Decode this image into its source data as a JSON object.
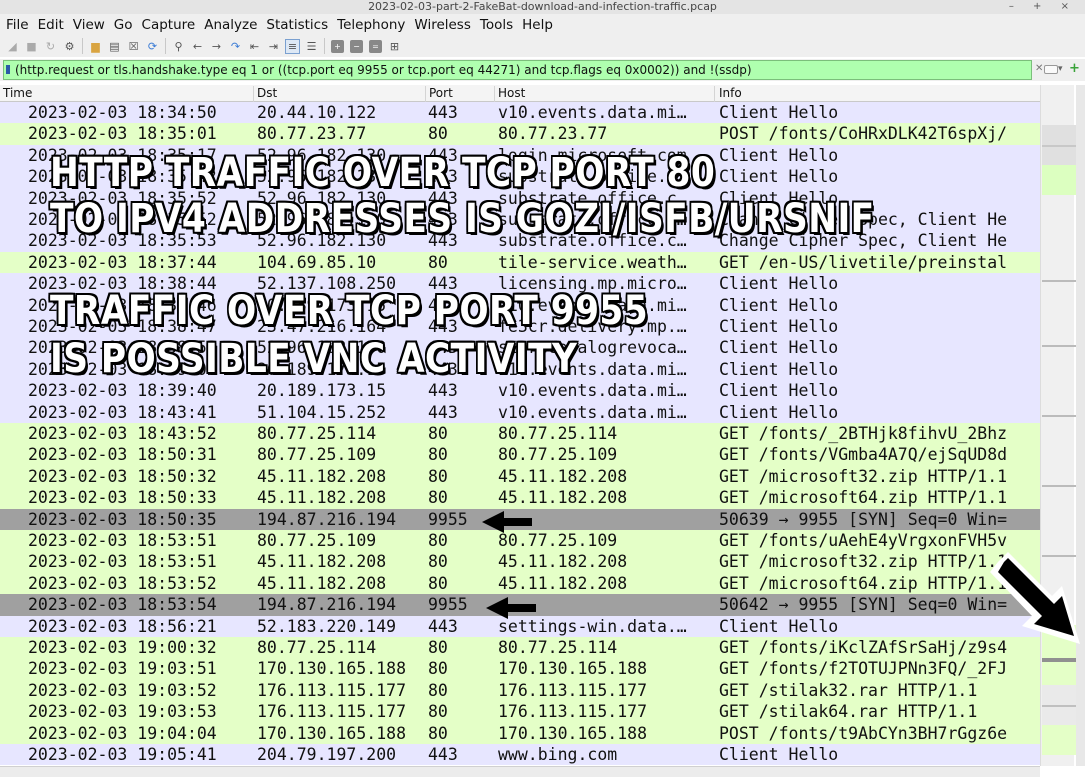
{
  "window": {
    "title": "2023-02-03-part-2-FakeBat-download-and-infection-traffic.pcap",
    "controls": "– + ×"
  },
  "menu": [
    "File",
    "Edit",
    "View",
    "Go",
    "Capture",
    "Analyze",
    "Statistics",
    "Telephony",
    "Wireless",
    "Tools",
    "Help"
  ],
  "toolbar": {
    "icons": [
      "shark-fin-icon",
      "stop-icon",
      "restart-icon",
      "options-gear-icon",
      "open-folder-icon",
      "file-icon",
      "close-file-icon",
      "reload-icon",
      "search-icon",
      "back-icon",
      "forward-icon",
      "jump-icon",
      "first-packet-icon",
      "last-packet-icon",
      "autoscroll-icon",
      "colorize-icon",
      "zoom-in-icon",
      "zoom-out-icon",
      "normal-size-icon",
      "resize-columns-icon"
    ]
  },
  "filter": {
    "value": "(http.request or tls.handshake.type eq 1 or ((tcp.port eq 9955 or tcp.port eq 44271) and tcp.flags eq 0x0002)) and !(ssdp)",
    "bg_color": "#afffaf"
  },
  "columns": [
    "Time",
    "Dst",
    "Port",
    "Host",
    "Info"
  ],
  "packets": [
    {
      "time": "2023-02-03 18:34:50",
      "dst": "20.44.10.122",
      "port": "443",
      "host": "v10.events.data.mi…",
      "info": "Client Hello",
      "type": "tls"
    },
    {
      "time": "2023-02-03 18:35:01",
      "dst": "80.77.23.77",
      "port": "80",
      "host": "80.77.23.77",
      "info": "POST /fonts/CoHRxDLK42T6spXj/",
      "type": "http"
    },
    {
      "time": "2023-02-03 18:35:17",
      "dst": "52.96.182.130",
      "port": "443",
      "host": "login.microsoft.com",
      "info": "Client Hello",
      "type": "tls"
    },
    {
      "time": "2023-02-03 18:35:42",
      "dst": "52.96.182.130",
      "port": "443",
      "host": "substrate.office.c…",
      "info": "Client Hello",
      "type": "tls"
    },
    {
      "time": "2023-02-03 18:35:52",
      "dst": "52.96.182.130",
      "port": "443",
      "host": "substrate.office.c…",
      "info": "Client Hello",
      "type": "tls"
    },
    {
      "time": "2023-02-03 18:35:52",
      "dst": "52.96.182.130",
      "port": "443",
      "host": "substrate.office.c…",
      "info": "Change Cipher Spec, Client He",
      "type": "tls"
    },
    {
      "time": "2023-02-03 18:35:53",
      "dst": "52.96.182.130",
      "port": "443",
      "host": "substrate.office.c…",
      "info": "Change Cipher Spec, Client He",
      "type": "tls"
    },
    {
      "time": "2023-02-03 18:37:44",
      "dst": "104.69.85.10",
      "port": "80",
      "host": "tile-service.weath…",
      "info": "GET /en-US/livetile/preinstal",
      "type": "http"
    },
    {
      "time": "2023-02-03 18:38:44",
      "dst": "52.137.108.250",
      "port": "443",
      "host": "licensing.mp.micro…",
      "info": "Client Hello",
      "type": "tls"
    },
    {
      "time": "2023-02-03 18:38:46",
      "dst": "20.189.173.15",
      "port": "443",
      "host": "v10.events.data.mi…",
      "info": "Client Hello",
      "type": "tls"
    },
    {
      "time": "2023-02-03 18:38:47",
      "dst": "23.47.216.164",
      "port": "443",
      "host": "fe3cr.delivery.mp.…",
      "info": "Client Hello",
      "type": "tls"
    },
    {
      "time": "2023-02-03 18:38:52",
      "dst": "52.96.182.130",
      "port": "443",
      "host": "storecatalogrevoca…",
      "info": "Client Hello",
      "type": "tls"
    },
    {
      "time": "2023-02-03 18:39:02",
      "dst": "20.189.173.15",
      "port": "443",
      "host": "v10.events.data.mi…",
      "info": "Client Hello",
      "type": "tls"
    },
    {
      "time": "2023-02-03 18:39:40",
      "dst": "20.189.173.15",
      "port": "443",
      "host": "v10.events.data.mi…",
      "info": "Client Hello",
      "type": "tls"
    },
    {
      "time": "2023-02-03 18:43:41",
      "dst": "51.104.15.252",
      "port": "443",
      "host": "v10.events.data.mi…",
      "info": "Client Hello",
      "type": "tls"
    },
    {
      "time": "2023-02-03 18:43:52",
      "dst": "80.77.25.114",
      "port": "80",
      "host": "80.77.25.114",
      "info": "GET /fonts/_2BTHjk8fihvU_2Bhz",
      "type": "http"
    },
    {
      "time": "2023-02-03 18:50:31",
      "dst": "80.77.25.109",
      "port": "80",
      "host": "80.77.25.109",
      "info": "GET /fonts/VGmba4A7Q/ejSqUD8d",
      "type": "http"
    },
    {
      "time": "2023-02-03 18:50:32",
      "dst": "45.11.182.208",
      "port": "80",
      "host": "45.11.182.208",
      "info": "GET /microsoft32.zip HTTP/1.1",
      "type": "http"
    },
    {
      "time": "2023-02-03 18:50:33",
      "dst": "45.11.182.208",
      "port": "80",
      "host": "45.11.182.208",
      "info": "GET /microsoft64.zip HTTP/1.1",
      "type": "http"
    },
    {
      "time": "2023-02-03 18:50:35",
      "dst": "194.87.216.194",
      "port": "9955",
      "host": "",
      "info": "50639 → 9955 [SYN] Seq=0 Win=",
      "type": "syn"
    },
    {
      "time": "2023-02-03 18:53:51",
      "dst": "80.77.25.109",
      "port": "80",
      "host": "80.77.25.109",
      "info": "GET /fonts/uAehE4yVrgxonFVH5v",
      "type": "http"
    },
    {
      "time": "2023-02-03 18:53:51",
      "dst": "45.11.182.208",
      "port": "80",
      "host": "45.11.182.208",
      "info": "GET /microsoft32.zip HTTP/1.1",
      "type": "http"
    },
    {
      "time": "2023-02-03 18:53:52",
      "dst": "45.11.182.208",
      "port": "80",
      "host": "45.11.182.208",
      "info": "GET /microsoft64.zip HTTP/1.1",
      "type": "http"
    },
    {
      "time": "2023-02-03 18:53:54",
      "dst": "194.87.216.194",
      "port": "9955",
      "host": "",
      "info": "50642 → 9955 [SYN] Seq=0 Win=",
      "type": "syn"
    },
    {
      "time": "2023-02-03 18:56:21",
      "dst": "52.183.220.149",
      "port": "443",
      "host": "settings-win.data.…",
      "info": "Client Hello",
      "type": "tls"
    },
    {
      "time": "2023-02-03 19:00:32",
      "dst": "80.77.25.114",
      "port": "80",
      "host": "80.77.25.114",
      "info": "GET /fonts/iKclZAfSrSaHj/z9s4",
      "type": "http"
    },
    {
      "time": "2023-02-03 19:03:51",
      "dst": "170.130.165.188",
      "port": "80",
      "host": "170.130.165.188",
      "info": "GET /fonts/f2TOTUJPNn3FQ/_2FJ",
      "type": "http"
    },
    {
      "time": "2023-02-03 19:03:52",
      "dst": "176.113.115.177",
      "port": "80",
      "host": "176.113.115.177",
      "info": "GET /stilak32.rar HTTP/1.1",
      "type": "http"
    },
    {
      "time": "2023-02-03 19:03:53",
      "dst": "176.113.115.177",
      "port": "80",
      "host": "176.113.115.177",
      "info": "GET /stilak64.rar HTTP/1.1",
      "type": "http"
    },
    {
      "time": "2023-02-03 19:04:04",
      "dst": "170.130.165.188",
      "port": "80",
      "host": "170.130.165.188",
      "info": "POST /fonts/t9AbCYn3BH7rGgz6e",
      "type": "http"
    },
    {
      "time": "2023-02-03 19:05:41",
      "dst": "204.79.197.200",
      "port": "443",
      "host": "www.bing.com",
      "info": "Client Hello",
      "type": "tls"
    }
  ],
  "annotations": {
    "gozi_line1": "HTTP TRAFFIC OVER TCP PORT 80",
    "gozi_line2": "TO IPV4 ADDRESSES IS GOZI/ISFB/URSNIF",
    "vnc_line1": "TRAFFIC OVER TCP PORT 9955",
    "vnc_line2": "IS POSSIBLE VNC ACTIVITY"
  },
  "colors": {
    "tls_row": "#e7e6ff",
    "http_row": "#e4ffc7",
    "syn_row": "#a0a0a0"
  }
}
